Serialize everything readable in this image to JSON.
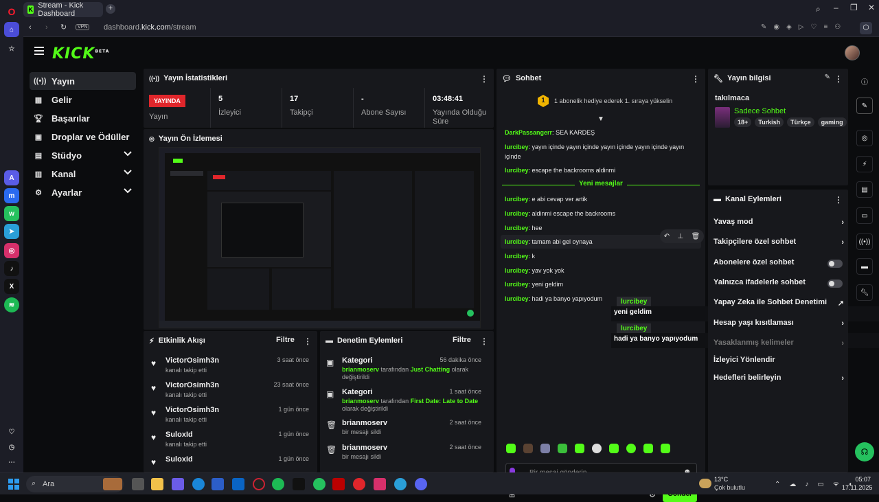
{
  "browser": {
    "tab_title": "Stream - Kick Dashboard",
    "url_prefix": "dashboard.",
    "url_domain": "kick.com",
    "url_path": "/stream",
    "vpn_label": "VPN"
  },
  "brand": {
    "logo": "KICK",
    "logo_sup": "BETA"
  },
  "nav": [
    {
      "label": "Yayın",
      "icon": "broadcast-icon"
    },
    {
      "label": "Gelir",
      "icon": "income-icon"
    },
    {
      "label": "Başarılar",
      "icon": "trophy-icon"
    },
    {
      "label": "Droplar ve Ödüller",
      "icon": "gift-icon"
    },
    {
      "label": "Stüdyo",
      "icon": "studio-icon"
    },
    {
      "label": "Kanal",
      "icon": "channel-icon"
    },
    {
      "label": "Ayarlar",
      "icon": "settings-icon"
    }
  ],
  "stats": {
    "title": "Yayın İstatistikleri",
    "live": "YAYINDA",
    "live_label": "Yayın",
    "items": [
      {
        "value": "5",
        "label": "İzleyici"
      },
      {
        "value": "17",
        "label": "Takipçi"
      },
      {
        "value": "-",
        "label": "Abone Sayısı"
      },
      {
        "value": "03:48:41",
        "label": "Yayında Olduğu Süre"
      }
    ]
  },
  "preview": {
    "title": "Yayın Ön İzlemesi"
  },
  "activity": {
    "title": "Etkinlik Akışı",
    "filter": "Filtre",
    "items": [
      {
        "name": "VictorOsimh3n",
        "sub": "kanalı takip etti",
        "time": "3 saat önce"
      },
      {
        "name": "VictorOsimh3n",
        "sub": "kanalı takip etti",
        "time": "23 saat önce"
      },
      {
        "name": "VictorOsimh3n",
        "sub": "kanalı takip etti",
        "time": "1 gün önce"
      },
      {
        "name": "SuloxId",
        "sub": "kanalı takip etti",
        "time": "1 gün önce"
      },
      {
        "name": "SuloxId",
        "sub": "",
        "time": "1 gün önce"
      }
    ]
  },
  "moderation": {
    "title": "Denetim Eylemleri",
    "filter": "Filtre",
    "items": [
      {
        "title": "Kategori",
        "user": "brianmoserv",
        "mid": "tarafından",
        "target": "Just Chatting",
        "end": "olarak değiştirildi",
        "time": "56 dakika önce"
      },
      {
        "title": "Kategori",
        "user": "brianmoserv",
        "mid": "tarafından",
        "target": "First Date: Late to Date",
        "end": "olarak değiştirildi",
        "time": "1 saat önce"
      },
      {
        "title": "brianmoserv",
        "user": "",
        "mid": "bir mesajı sildi",
        "target": "",
        "end": "",
        "time": "2 saat önce"
      },
      {
        "title": "brianmoserv",
        "user": "",
        "mid": "bir mesajı sildi",
        "target": "",
        "end": "",
        "time": "2 saat önce"
      }
    ]
  },
  "chat": {
    "title": "Sohbet",
    "gift_banner": "1 abonelik hediye ederek 1. sıraya yükselin",
    "gift_rank": "1",
    "new_messages": "Yeni mesajlar",
    "messages_before": [
      {
        "user": "DarkPassangerr",
        "text": "SEA KARDEŞ"
      },
      {
        "user": "lurcibey",
        "text": "yayın içinde yayın içinde yayın içinde yayın içinde yayın içinde"
      },
      {
        "user": "lurcibey",
        "text": "escape the backrooms aldinmi"
      }
    ],
    "messages_after": [
      {
        "user": "lurcibey",
        "text": "e abi cevap ver artik"
      },
      {
        "user": "lurcibey",
        "text": "aldinmi escape the backrooms"
      },
      {
        "user": "lurcibey",
        "text": "hee"
      },
      {
        "user": "lurcibey",
        "text": "tamam abi gel oynaya"
      },
      {
        "user": "lurcibey",
        "text": "k"
      },
      {
        "user": "lurcibey",
        "text": "yav yok yok"
      },
      {
        "user": "lurcibey",
        "text": "yeni geldim"
      },
      {
        "user": "lurcibey",
        "text": "hadi ya banyo yapıyodum"
      }
    ],
    "overlay_user_1": "lurcibey",
    "overlay_text_1": "yeni geldim",
    "overlay_user_2": "lurcibey",
    "overlay_text_2": "hadi ya banyo yapıyodum",
    "input_placeholder": "Bir mesaj gönderin",
    "send": "Gönder"
  },
  "stream_info": {
    "title": "Yayın bilgisi",
    "stream_title": "takılmaca",
    "category": "Sadece Sohbet",
    "tags": [
      "18+",
      "Turkish",
      "Türkçe",
      "gaming"
    ]
  },
  "channel_actions": {
    "title": "Kanal Eylemleri",
    "items": [
      {
        "label": "Yavaş mod",
        "control": "chevron"
      },
      {
        "label": "Takipçilere özel sohbet",
        "control": "chevron"
      },
      {
        "label": "Abonelere özel sohbet",
        "control": "toggle"
      },
      {
        "label": "Yalnızca ifadelerle sohbet",
        "control": "toggle"
      },
      {
        "label": "Yapay Zeka ile Sohbet Denetimi",
        "control": "external"
      },
      {
        "label": "Hesap yaşı kısıtlaması",
        "control": "chevron"
      },
      {
        "label": "Yasaklanmış kelimeler",
        "control": "chevron"
      },
      {
        "label": "İzleyici Yönlendir",
        "control": "none"
      },
      {
        "label": "Hedefleri belirleyin",
        "control": "chevron"
      }
    ]
  },
  "taskbar": {
    "search": "Ara",
    "weather_temp": "13°C",
    "weather_desc": "Çok bulutlu",
    "time": "05:07",
    "date": "17.11.2025"
  },
  "colors": {
    "accent": "#53fc18",
    "live": "#e0262b",
    "panel": "#17181c",
    "background": "#0b0c0e"
  }
}
